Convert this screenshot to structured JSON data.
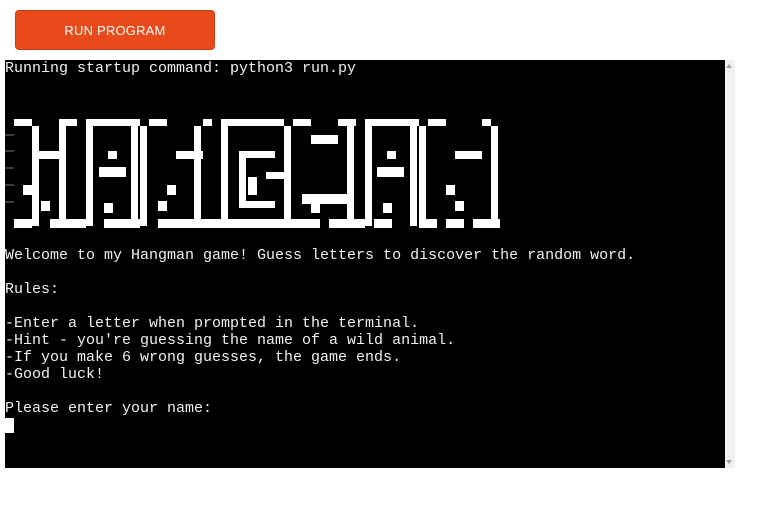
{
  "toolbar": {
    "run_label": "RUN PROGRAM",
    "accent_color": "#e84a1b"
  },
  "terminal": {
    "startup": "Running startup command: python3 run.py",
    "banner_text": "HANGMAN",
    "welcome": "Welcome to my Hangman game! Guess letters to discover the random word.",
    "rules_heading": "Rules:",
    "rules": [
      "-Enter a letter when prompted in the terminal.",
      "-Hint - you're guessing the name of a wild animal.",
      "-If you make 6 wrong guesses, the game ends.",
      "-Good luck!"
    ],
    "prompt": "Please enter your name:"
  }
}
